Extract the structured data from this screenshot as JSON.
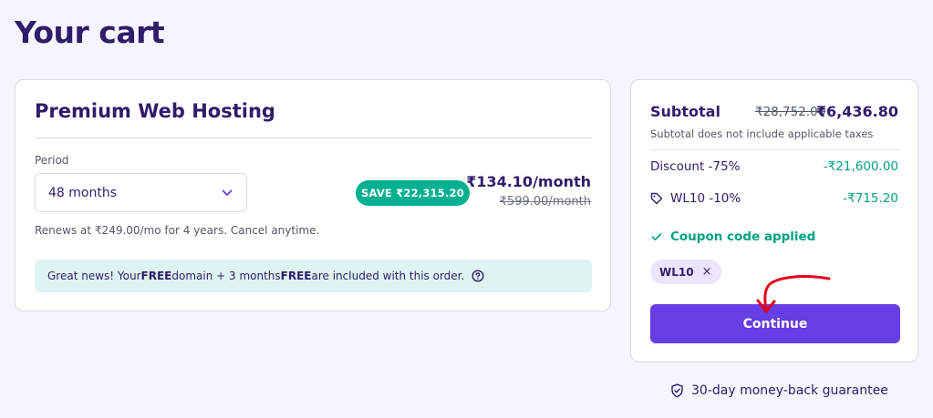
{
  "page": {
    "title": "Your cart"
  },
  "product": {
    "title": "Premium Web Hosting",
    "period_label": "Period",
    "period_value": "48 months",
    "save_badge": "SAVE ₹22,315.20",
    "price_now": "₹134.10/month",
    "price_old": "₹599.00/month",
    "renew_text": "Renews at ₹249.00/mo for 4 years. Cancel anytime.",
    "banner": {
      "part1": "Great news! Your ",
      "free1": "FREE",
      "part2": " domain + 3 months ",
      "free2": "FREE",
      "part3": " are included with this order."
    }
  },
  "summary": {
    "subtotal_label": "Subtotal",
    "subtotal_old": "₹28,752.00",
    "subtotal_new": "₹6,436.80",
    "subtotal_note": "Subtotal does not include applicable taxes",
    "discount_label": "Discount -75%",
    "discount_value": "-₹21,600.00",
    "coupon_label": "WL10 -10%",
    "coupon_value": "-₹715.20",
    "applied_text": "Coupon code applied",
    "chip_label": "WL10",
    "chip_remove": "×",
    "continue_label": "Continue"
  },
  "guarantee": "30-day money-back guarantee",
  "colors": {
    "primary": "#673de6",
    "success": "#00b090",
    "text": "#2f1c6a",
    "annotation": "#e8001c"
  }
}
